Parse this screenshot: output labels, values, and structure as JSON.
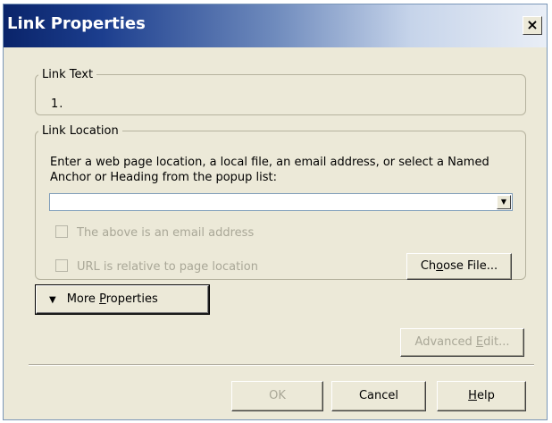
{
  "window": {
    "title": "Link Properties",
    "close_symbol": "×"
  },
  "link_text": {
    "legend": "Link Text",
    "value": "1."
  },
  "link_location": {
    "legend": "Link Location",
    "description": "Enter a web page location, a local file, an email address, or select a Named Anchor or Heading from the popup list:",
    "url_value": "",
    "email_checkbox_label": "The above is an email address",
    "relative_checkbox_label": "URL is relative to page location",
    "choose_file_pre": "Ch",
    "choose_file_key": "o",
    "choose_file_post": "ose File..."
  },
  "more_properties": {
    "pre": "More ",
    "key": "P",
    "post": "roperties"
  },
  "advanced_edit": {
    "pre": "Advanced ",
    "key": "E",
    "post": "dit..."
  },
  "buttons": {
    "ok": "OK",
    "cancel": "Cancel",
    "help_key": "H",
    "help_post": "elp"
  },
  "colors": {
    "dialog_bg": "#ece9d8",
    "title_bg_start": "#0a246a",
    "disabled_text": "#a9a797"
  }
}
